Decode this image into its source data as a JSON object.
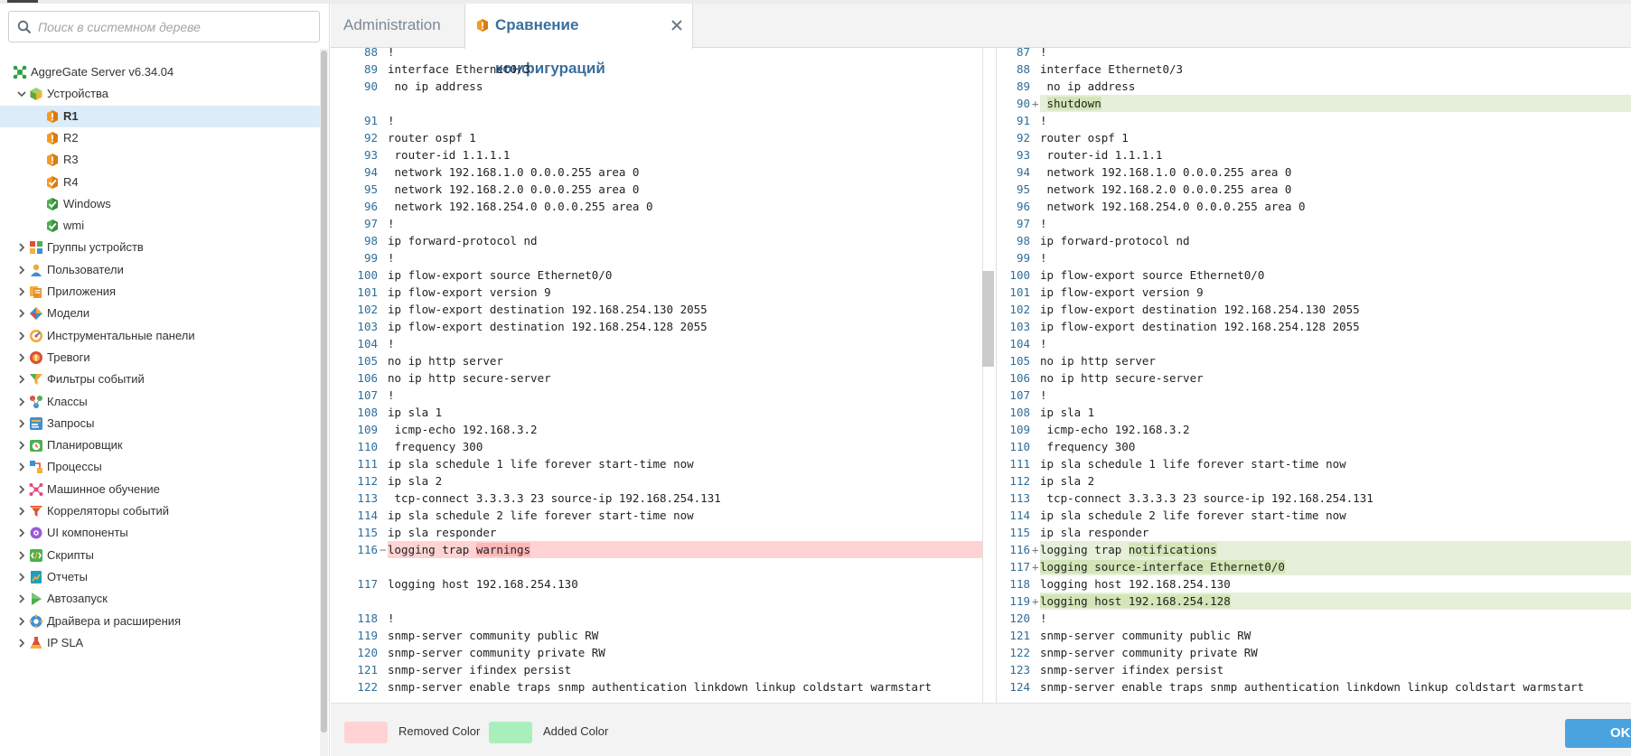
{
  "colors": {
    "removed": "#ffd3d3",
    "removed_highlight": "#ffb7b7",
    "added": "#e6efda",
    "added_highlight": "#d3e6b8",
    "legend_added": "#a8efbb",
    "line_number": "#2d6e9a",
    "ok_button": "#4aa3df",
    "selected_row": "#dcecf8"
  },
  "sidebar": {
    "search_placeholder": "Поиск в системном дереве",
    "tree": [
      {
        "label": "AggreGate Server v6.34.04",
        "icon": "server-root-icon",
        "depth": 0,
        "chevron": "none",
        "name": "tree-item-aggregate-server"
      },
      {
        "label": "Устройства",
        "icon": "devices-icon",
        "depth": 1,
        "chevron": "expanded",
        "name": "tree-item-devices"
      },
      {
        "label": "R1",
        "icon": "device-warning-icon",
        "depth": 2,
        "chevron": "none",
        "name": "tree-item-r1",
        "selected": true,
        "bold": true
      },
      {
        "label": "R2",
        "icon": "device-warning-icon",
        "depth": 2,
        "chevron": "none",
        "name": "tree-item-r2"
      },
      {
        "label": "R3",
        "icon": "device-warning-icon",
        "depth": 2,
        "chevron": "none",
        "name": "tree-item-r3"
      },
      {
        "label": "R4",
        "icon": "device-ok-warning-icon",
        "depth": 2,
        "chevron": "none",
        "name": "tree-item-r4"
      },
      {
        "label": "Windows",
        "icon": "device-ok-icon",
        "depth": 2,
        "chevron": "none",
        "name": "tree-item-windows"
      },
      {
        "label": "wmi",
        "icon": "device-ok-icon",
        "depth": 2,
        "chevron": "none",
        "name": "tree-item-wmi"
      },
      {
        "label": "Группы устройств",
        "icon": "device-groups-icon",
        "depth": 1,
        "chevron": "collapsed",
        "name": "tree-item-device-groups"
      },
      {
        "label": "Пользователи",
        "icon": "users-icon",
        "depth": 1,
        "chevron": "collapsed",
        "name": "tree-item-users"
      },
      {
        "label": "Приложения",
        "icon": "applications-icon",
        "depth": 1,
        "chevron": "collapsed",
        "name": "tree-item-applications"
      },
      {
        "label": "Модели",
        "icon": "models-icon",
        "depth": 1,
        "chevron": "collapsed",
        "name": "tree-item-models"
      },
      {
        "label": "Инструментальные панели",
        "icon": "dashboards-icon",
        "depth": 1,
        "chevron": "collapsed",
        "name": "tree-item-dashboards"
      },
      {
        "label": "Тревоги",
        "icon": "alerts-icon",
        "depth": 1,
        "chevron": "collapsed",
        "name": "tree-item-alerts"
      },
      {
        "label": "Фильтры событий",
        "icon": "event-filters-icon",
        "depth": 1,
        "chevron": "collapsed",
        "name": "tree-item-event-filters"
      },
      {
        "label": "Классы",
        "icon": "classes-icon",
        "depth": 1,
        "chevron": "collapsed",
        "name": "tree-item-classes"
      },
      {
        "label": "Запросы",
        "icon": "queries-icon",
        "depth": 1,
        "chevron": "collapsed",
        "name": "tree-item-queries"
      },
      {
        "label": "Планировщик",
        "icon": "scheduler-icon",
        "depth": 1,
        "chevron": "collapsed",
        "name": "tree-item-scheduler"
      },
      {
        "label": "Процессы",
        "icon": "processes-icon",
        "depth": 1,
        "chevron": "collapsed",
        "name": "tree-item-processes"
      },
      {
        "label": "Машинное обучение",
        "icon": "machine-learning-icon",
        "depth": 1,
        "chevron": "collapsed",
        "name": "tree-item-machine-learning"
      },
      {
        "label": "Корреляторы событий",
        "icon": "event-correlators-icon",
        "depth": 1,
        "chevron": "collapsed",
        "name": "tree-item-event-correlators"
      },
      {
        "label": "UI компоненты",
        "icon": "ui-components-icon",
        "depth": 1,
        "chevron": "collapsed",
        "name": "tree-item-ui-components"
      },
      {
        "label": "Скрипты",
        "icon": "scripts-icon",
        "depth": 1,
        "chevron": "collapsed",
        "name": "tree-item-scripts"
      },
      {
        "label": "Отчеты",
        "icon": "reports-icon",
        "depth": 1,
        "chevron": "collapsed",
        "name": "tree-item-reports"
      },
      {
        "label": "Автозапуск",
        "icon": "autorun-icon",
        "depth": 1,
        "chevron": "collapsed",
        "name": "tree-item-autorun"
      },
      {
        "label": "Драйвера и расширения",
        "icon": "drivers-icon",
        "depth": 1,
        "chevron": "collapsed",
        "name": "tree-item-drivers"
      },
      {
        "label": "IP SLA",
        "icon": "ip-sla-icon",
        "depth": 1,
        "chevron": "collapsed",
        "name": "tree-item-ip-sla"
      }
    ]
  },
  "tabs": {
    "admin_label": "Administration",
    "compare_label": "Сравнение конфигураций"
  },
  "diff": {
    "left": [
      {
        "n": "88",
        "t": "!"
      },
      {
        "n": "89",
        "t": "interface Ethernet0/3"
      },
      {
        "n": "90",
        "t": " no ip address"
      },
      {
        "type": "gap"
      },
      {
        "n": "91",
        "t": "!"
      },
      {
        "n": "92",
        "t": "router ospf 1"
      },
      {
        "n": "93",
        "t": " router-id 1.1.1.1"
      },
      {
        "n": "94",
        "t": " network 192.168.1.0 0.0.0.255 area 0"
      },
      {
        "n": "95",
        "t": " network 192.168.2.0 0.0.0.255 area 0"
      },
      {
        "n": "96",
        "t": " network 192.168.254.0 0.0.0.255 area 0"
      },
      {
        "n": "97",
        "t": "!"
      },
      {
        "n": "98",
        "t": "ip forward-protocol nd"
      },
      {
        "n": "99",
        "t": "!"
      },
      {
        "n": "100",
        "t": "ip flow-export source Ethernet0/0"
      },
      {
        "n": "101",
        "t": "ip flow-export version 9"
      },
      {
        "n": "102",
        "t": "ip flow-export destination 192.168.254.130 2055"
      },
      {
        "n": "103",
        "t": "ip flow-export destination 192.168.254.128 2055"
      },
      {
        "n": "104",
        "t": "!"
      },
      {
        "n": "105",
        "t": "no ip http server"
      },
      {
        "n": "106",
        "t": "no ip http secure-server"
      },
      {
        "n": "107",
        "t": "!"
      },
      {
        "n": "108",
        "t": "ip sla 1"
      },
      {
        "n": "109",
        "t": " icmp-echo 192.168.3.2"
      },
      {
        "n": "110",
        "t": " frequency 300"
      },
      {
        "n": "111",
        "t": "ip sla schedule 1 life forever start-time now"
      },
      {
        "n": "112",
        "t": "ip sla 2"
      },
      {
        "n": "113",
        "t": " tcp-connect 3.3.3.3 23 source-ip 192.168.254.131"
      },
      {
        "n": "114",
        "t": "ip sla schedule 2 life forever start-time now"
      },
      {
        "n": "115",
        "t": "ip sla responder"
      },
      {
        "n": "116",
        "type": "removed",
        "m": "−",
        "t": "logging trap ",
        "h": "warnings"
      },
      {
        "type": "gap"
      },
      {
        "n": "117",
        "t": "logging host 192.168.254.130"
      },
      {
        "type": "gap"
      },
      {
        "n": "118",
        "t": "!"
      },
      {
        "n": "119",
        "t": "snmp-server community public RW"
      },
      {
        "n": "120",
        "t": "snmp-server community private RW"
      },
      {
        "n": "121",
        "t": "snmp-server ifindex persist"
      },
      {
        "n": "122",
        "t": "snmp-server enable traps snmp authentication linkdown linkup coldstart warmstart"
      }
    ],
    "right": [
      {
        "n": "87",
        "t": "!"
      },
      {
        "n": "88",
        "t": "interface Ethernet0/3"
      },
      {
        "n": "89",
        "t": " no ip address"
      },
      {
        "n": "90",
        "type": "added",
        "m": "+",
        "t": " ",
        "h": "shutdown"
      },
      {
        "n": "91",
        "t": "!"
      },
      {
        "n": "92",
        "t": "router ospf 1"
      },
      {
        "n": "93",
        "t": " router-id 1.1.1.1"
      },
      {
        "n": "94",
        "t": " network 192.168.1.0 0.0.0.255 area 0"
      },
      {
        "n": "95",
        "t": " network 192.168.2.0 0.0.0.255 area 0"
      },
      {
        "n": "96",
        "t": " network 192.168.254.0 0.0.0.255 area 0"
      },
      {
        "n": "97",
        "t": "!"
      },
      {
        "n": "98",
        "t": "ip forward-protocol nd"
      },
      {
        "n": "99",
        "t": "!"
      },
      {
        "n": "100",
        "t": "ip flow-export source Ethernet0/0"
      },
      {
        "n": "101",
        "t": "ip flow-export version 9"
      },
      {
        "n": "102",
        "t": "ip flow-export destination 192.168.254.130 2055"
      },
      {
        "n": "103",
        "t": "ip flow-export destination 192.168.254.128 2055"
      },
      {
        "n": "104",
        "t": "!"
      },
      {
        "n": "105",
        "t": "no ip http server"
      },
      {
        "n": "106",
        "t": "no ip http secure-server"
      },
      {
        "n": "107",
        "t": "!"
      },
      {
        "n": "108",
        "t": "ip sla 1"
      },
      {
        "n": "109",
        "t": " icmp-echo 192.168.3.2"
      },
      {
        "n": "110",
        "t": " frequency 300"
      },
      {
        "n": "111",
        "t": "ip sla schedule 1 life forever start-time now"
      },
      {
        "n": "112",
        "t": "ip sla 2"
      },
      {
        "n": "113",
        "t": " tcp-connect 3.3.3.3 23 source-ip 192.168.254.131"
      },
      {
        "n": "114",
        "t": "ip sla schedule 2 life forever start-time now"
      },
      {
        "n": "115",
        "t": "ip sla responder"
      },
      {
        "n": "116",
        "type": "added",
        "m": "+",
        "t": "logging trap ",
        "h": "notifications"
      },
      {
        "n": "117",
        "type": "added",
        "m": "+",
        "t": "",
        "h": "logging source-interface Ethernet0/0"
      },
      {
        "n": "118",
        "t": "logging host 192.168.254.130"
      },
      {
        "n": "119",
        "type": "added",
        "m": "+",
        "t": "",
        "h": "logging host 192.168.254.128"
      },
      {
        "n": "120",
        "t": "!"
      },
      {
        "n": "121",
        "t": "snmp-server community public RW"
      },
      {
        "n": "122",
        "t": "snmp-server community private RW"
      },
      {
        "n": "123",
        "t": "snmp-server ifindex persist"
      },
      {
        "n": "124",
        "t": "snmp-server enable traps snmp authentication linkdown linkup coldstart warmstart"
      }
    ]
  },
  "legend": {
    "removed_label": "Removed Color",
    "added_label": "Added Color"
  },
  "ok_label": "OK"
}
